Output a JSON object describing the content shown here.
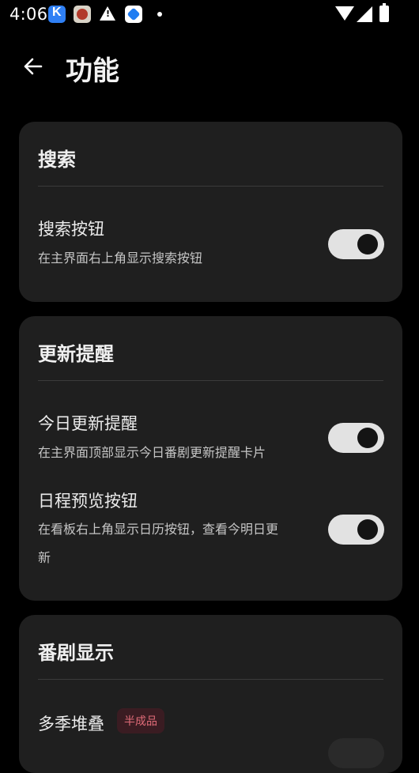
{
  "status_bar": {
    "time": "4:06",
    "icons": [
      "app-k-icon",
      "app-red-icon",
      "warning-icon",
      "app-blue-icon",
      "dot-icon",
      "wifi-icon",
      "signal-icon",
      "battery-icon"
    ]
  },
  "header": {
    "title": "功能",
    "back_icon": "arrow-left-icon"
  },
  "cards": {
    "search": {
      "title": "搜索",
      "item_title": "搜索按钮",
      "item_desc": "在主界面右上角显示搜索按钮",
      "toggle_on": true
    },
    "reminder": {
      "title": "更新提醒",
      "items": [
        {
          "title": "今日更新提醒",
          "desc": "在主界面顶部显示今日番剧更新提醒卡片",
          "toggle_on": true
        },
        {
          "title": "日程预览按钮",
          "desc_line1": "在看板右上角显示日历按钮，查看今明日更",
          "desc_line2": "新",
          "toggle_on": true
        }
      ]
    },
    "display": {
      "title": "番剧显示",
      "item_title": "多季堆叠",
      "badge": "半成品"
    }
  },
  "colors": {
    "background": "#000000",
    "card": "#1f1f1f",
    "toggle_track": "#e2e2e2",
    "badge_text": "#e06b78"
  }
}
